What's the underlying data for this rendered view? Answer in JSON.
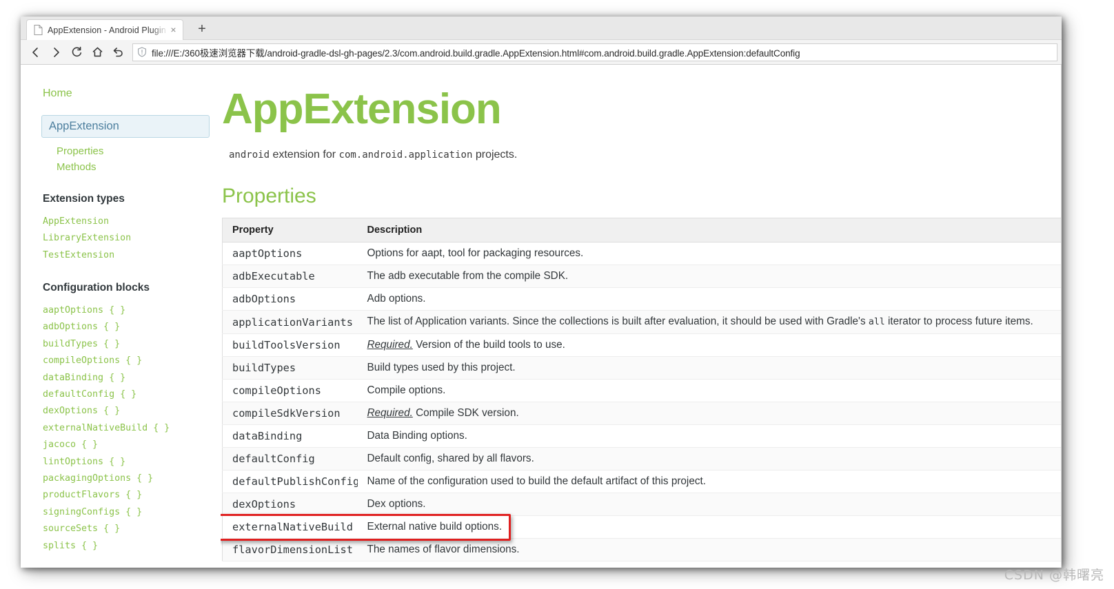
{
  "browser": {
    "tab": {
      "title": "AppExtension - Android Plugin DSL Reference",
      "favicon": "page-icon",
      "close_label": "×"
    },
    "newtab_label": "+",
    "nav": {
      "back": "back-arrow",
      "forward": "forward-arrow",
      "reload": "reload-arrow",
      "home": "home-icon",
      "history": "undo-arrow"
    },
    "omnibox": {
      "security_icon": "shield-icon",
      "url": "file:///E:/360极速浏览器下载/android-gradle-dsl-gh-pages/2.3/com.android.build.gradle.AppExtension.html#com.android.build.gradle.AppExtension:defaultConfig"
    }
  },
  "sidebar": {
    "home": "Home",
    "current": "AppExtension",
    "sub_links": [
      "Properties",
      "Methods"
    ],
    "sections": [
      {
        "heading": "Extension types",
        "items": [
          "AppExtension",
          "LibraryExtension",
          "TestExtension"
        ]
      },
      {
        "heading": "Configuration blocks",
        "items": [
          "aaptOptions { }",
          "adbOptions { }",
          "buildTypes { }",
          "compileOptions { }",
          "dataBinding { }",
          "defaultConfig { }",
          "dexOptions { }",
          "externalNativeBuild { }",
          "jacoco { }",
          "lintOptions { }",
          "packagingOptions { }",
          "productFlavors { }",
          "signingConfigs { }",
          "sourceSets { }",
          "splits { }"
        ]
      }
    ]
  },
  "main": {
    "title": "AppExtension",
    "intro": {
      "code1": "android",
      "text1": " extension for ",
      "code2": "com.android.application",
      "text2": " projects."
    },
    "section_title": "Properties",
    "table": {
      "headers": [
        "Property",
        "Description"
      ],
      "rows": [
        {
          "property": "aaptOptions",
          "description": "Options for aapt, tool for packaging resources."
        },
        {
          "property": "adbExecutable",
          "description": "The adb executable from the compile SDK."
        },
        {
          "property": "adbOptions",
          "description": "Adb options."
        },
        {
          "property": "applicationVariants",
          "description": "The list of Application variants. Since the collections is built after evaluation, it should be used with Gradle's all iterator to process future items."
        },
        {
          "property": "buildToolsVersion",
          "description": "Required. Version of the build tools to use.",
          "required": true,
          "required_label": "Required.",
          "rest": " Version of the build tools to use."
        },
        {
          "property": "buildTypes",
          "description": "Build types used by this project."
        },
        {
          "property": "compileOptions",
          "description": "Compile options."
        },
        {
          "property": "compileSdkVersion",
          "description": "Required. Compile SDK version.",
          "required": true,
          "required_label": "Required.",
          "rest": " Compile SDK version."
        },
        {
          "property": "dataBinding",
          "description": "Data Binding options."
        },
        {
          "property": "defaultConfig",
          "description": "Default config, shared by all flavors."
        },
        {
          "property": "defaultPublishConfig",
          "description": "Name of the configuration used to build the default artifact of this project."
        },
        {
          "property": "dexOptions",
          "description": "Dex options."
        },
        {
          "property": "externalNativeBuild",
          "description": "External native build options.",
          "highlighted": true
        },
        {
          "property": "flavorDimensionList",
          "description": "The names of flavor dimensions."
        }
      ]
    }
  },
  "annotation": {
    "highlight_color": "#e02020",
    "highlight_target": "externalNativeBuild"
  },
  "watermark": "CSDN @韩曙亮"
}
